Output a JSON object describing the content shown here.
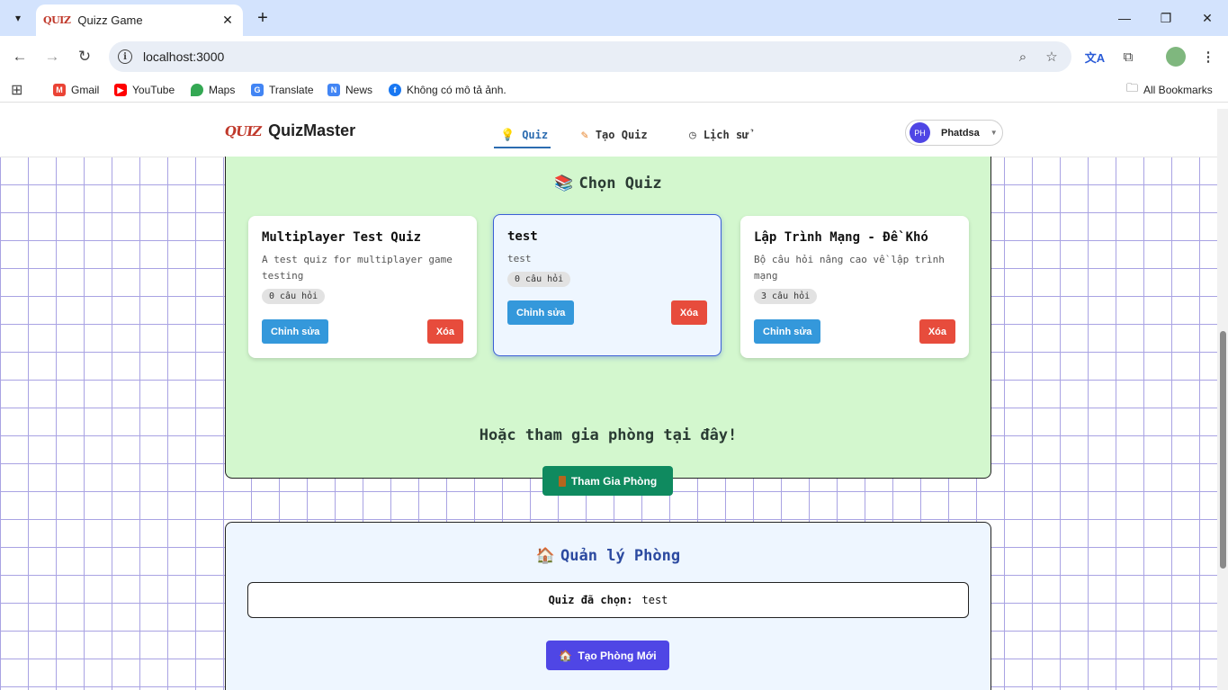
{
  "browser": {
    "tab_title": "Quizz Game",
    "tab_favicon_text": "QUIZ",
    "url": "localhost:3000",
    "bookmarks": [
      {
        "label": "Gmail",
        "icon": "gmail-icon",
        "color": "#ea4335"
      },
      {
        "label": "YouTube",
        "icon": "youtube-icon",
        "color": "#ff0000"
      },
      {
        "label": "Maps",
        "icon": "maps-icon",
        "color": "#34a853"
      },
      {
        "label": "Translate",
        "icon": "translate-icon",
        "color": "#4285f4"
      },
      {
        "label": "News",
        "icon": "news-icon",
        "color": "#4285f4"
      },
      {
        "label": "Không có mô tả ảnh.",
        "icon": "facebook-icon",
        "color": "#1877f2"
      }
    ],
    "all_bookmarks": "All Bookmarks"
  },
  "app": {
    "logo_text": "QUIZ",
    "brand": "QuizMaster",
    "nav": [
      {
        "label": "Quiz",
        "icon": "lightbulb-icon",
        "active": true
      },
      {
        "label": "Tạo Quiz",
        "icon": "pencil-icon",
        "active": false
      },
      {
        "label": "Lịch sử",
        "icon": "clock-icon",
        "active": false
      }
    ],
    "user": {
      "initials": "PH",
      "name": "Phatdsa"
    },
    "accent": "#2c6cb0"
  },
  "quiz_section": {
    "title": "Chọn Quiz",
    "cards": [
      {
        "title": "Multiplayer Test Quiz",
        "description": "A test quiz for multiplayer game testing",
        "count": "0 câu hỏi",
        "edit": "Chỉnh sửa",
        "delete": "Xóa",
        "selected": false
      },
      {
        "title": "test",
        "description": "test",
        "count": "0 câu hỏi",
        "edit": "Chỉnh sửa",
        "delete": "Xóa",
        "selected": true
      },
      {
        "title": "Lập Trình Mạng - Đề Khó",
        "description": "Bộ câu hỏi nâng cao về lập trình mạng",
        "count": "3 câu hỏi",
        "edit": "Chỉnh sửa",
        "delete": "Xóa",
        "selected": false
      }
    ],
    "join_heading": "Hoặc tham gia phòng tại đây!",
    "join_button": "Tham Gia Phòng"
  },
  "room_section": {
    "title": "Quản lý Phòng",
    "selected_label": "Quiz đã chọn:",
    "selected_value": "test",
    "create_button": "Tạo Phòng Mới"
  },
  "colors": {
    "green_panel": "#d3f7ce",
    "blue_panel": "#eef6ff",
    "edit_button": "#3498db",
    "delete_button": "#e74c3c",
    "join_button": "#0f8a5f",
    "create_button": "#4f46e5"
  }
}
